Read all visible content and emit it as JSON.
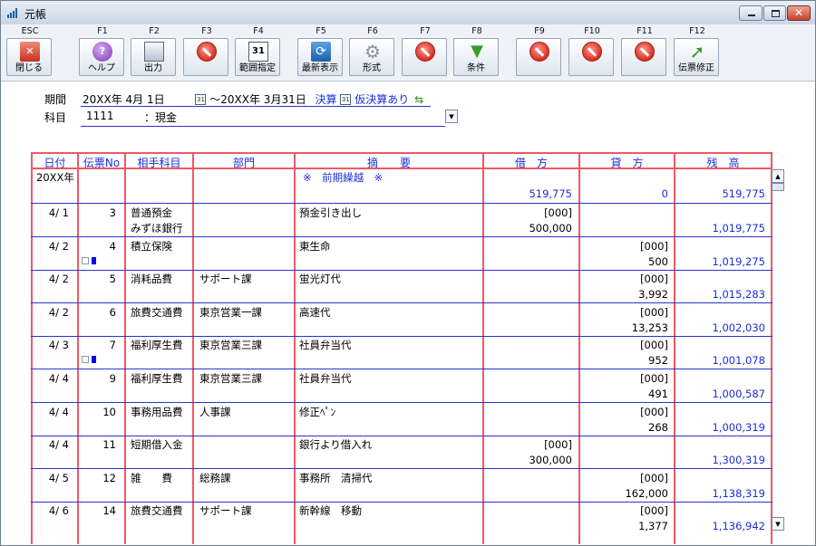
{
  "window": {
    "title": "元帳"
  },
  "toolbar": [
    {
      "key": "ESC",
      "label": "閉じる",
      "icon": "close-x-icon"
    },
    {
      "key": "F1",
      "label": "ヘルプ",
      "icon": "help-icon"
    },
    {
      "key": "F2",
      "label": "出力",
      "icon": "output-icon"
    },
    {
      "key": "F3",
      "label": "",
      "icon": "disabled-icon"
    },
    {
      "key": "F4",
      "label": "範囲指定",
      "icon": "calendar-icon"
    },
    {
      "key": "F5",
      "label": "最新表示",
      "icon": "refresh-icon"
    },
    {
      "key": "F6",
      "label": "形式",
      "icon": "gear-icon"
    },
    {
      "key": "F7",
      "label": "",
      "icon": "disabled-icon"
    },
    {
      "key": "F8",
      "label": "条件",
      "icon": "filter-icon"
    },
    {
      "key": "F9",
      "label": "",
      "icon": "disabled-icon"
    },
    {
      "key": "F10",
      "label": "",
      "icon": "disabled-icon"
    },
    {
      "key": "F11",
      "label": "",
      "icon": "disabled-icon"
    },
    {
      "key": "F12",
      "label": "伝票修正",
      "icon": "edit-arrow-icon"
    }
  ],
  "filter": {
    "period_label": "期間",
    "period_from": "20XX年  4月 1日",
    "period_to": "〜20XX年  3月31日",
    "settlement": "決算",
    "provisional": "仮決算あり",
    "account_label": "科目",
    "account_code": "1111",
    "account_name": "：現金"
  },
  "table": {
    "headers": [
      "日付",
      "伝票No",
      "相手科目",
      "部門",
      "摘　　要",
      "借　方",
      "貸　方",
      "残　高"
    ],
    "carryover": {
      "date": "20XX年",
      "summary": "※　前期繰越　※",
      "debit": "519,775",
      "credit": "0",
      "balance": "519,775"
    },
    "rows": [
      {
        "date": "4/ 1",
        "no": "3",
        "account": "普通預金",
        "account2": "みずほ銀行",
        "dept": "",
        "summary": "預金引き出し",
        "debit_tag": "[000]",
        "debit": "500,000",
        "credit_tag": "",
        "credit": "",
        "balance": "1,019,775",
        "flag": false
      },
      {
        "date": "4/ 2",
        "no": "4",
        "account": "積立保険",
        "account2": "",
        "dept": "",
        "summary": "東生命",
        "debit_tag": "",
        "debit": "",
        "credit_tag": "[000]",
        "credit": "500",
        "balance": "1,019,275",
        "flag": true
      },
      {
        "date": "4/ 2",
        "no": "5",
        "account": "消耗品費",
        "account2": "",
        "dept": "サポート課",
        "summary": "蛍光灯代",
        "debit_tag": "",
        "debit": "",
        "credit_tag": "[000]",
        "credit": "3,992",
        "balance": "1,015,283",
        "flag": false
      },
      {
        "date": "4/ 2",
        "no": "6",
        "account": "旅費交通費",
        "account2": "",
        "dept": "東京営業一課",
        "summary": "高速代",
        "debit_tag": "",
        "debit": "",
        "credit_tag": "[000]",
        "credit": "13,253",
        "balance": "1,002,030",
        "flag": false
      },
      {
        "date": "4/ 3",
        "no": "7",
        "account": "福利厚生費",
        "account2": "",
        "dept": "東京営業三課",
        "summary": "社員弁当代",
        "debit_tag": "",
        "debit": "",
        "credit_tag": "[000]",
        "credit": "952",
        "balance": "1,001,078",
        "flag": true
      },
      {
        "date": "4/ 4",
        "no": "9",
        "account": "福利厚生費",
        "account2": "",
        "dept": "東京営業三課",
        "summary": "社員弁当代",
        "debit_tag": "",
        "debit": "",
        "credit_tag": "[000]",
        "credit": "491",
        "balance": "1,000,587",
        "flag": false
      },
      {
        "date": "4/ 4",
        "no": "10",
        "account": "事務用品費",
        "account2": "",
        "dept": "人事課",
        "summary": "修正ﾍﾟﾝ",
        "debit_tag": "",
        "debit": "",
        "credit_tag": "[000]",
        "credit": "268",
        "balance": "1,000,319",
        "flag": false
      },
      {
        "date": "4/ 4",
        "no": "11",
        "account": "短期借入金",
        "account2": "",
        "dept": "",
        "summary": "銀行より借入れ",
        "debit_tag": "[000]",
        "debit": "300,000",
        "credit_tag": "",
        "credit": "",
        "balance": "1,300,319",
        "flag": false
      },
      {
        "date": "4/ 5",
        "no": "12",
        "account": "雑　　費",
        "account2": "",
        "dept": "総務課",
        "summary": "事務所　清掃代",
        "debit_tag": "",
        "debit": "",
        "credit_tag": "[000]",
        "credit": "162,000",
        "balance": "1,138,319",
        "flag": false
      },
      {
        "date": "4/ 6",
        "no": "14",
        "account": "旅費交通費",
        "account2": "",
        "dept": "サポート課",
        "summary": "新幹線　移動",
        "debit_tag": "",
        "debit": "",
        "credit_tag": "[000]",
        "credit": "1,377",
        "balance": "1,136,942",
        "flag": false
      }
    ]
  }
}
